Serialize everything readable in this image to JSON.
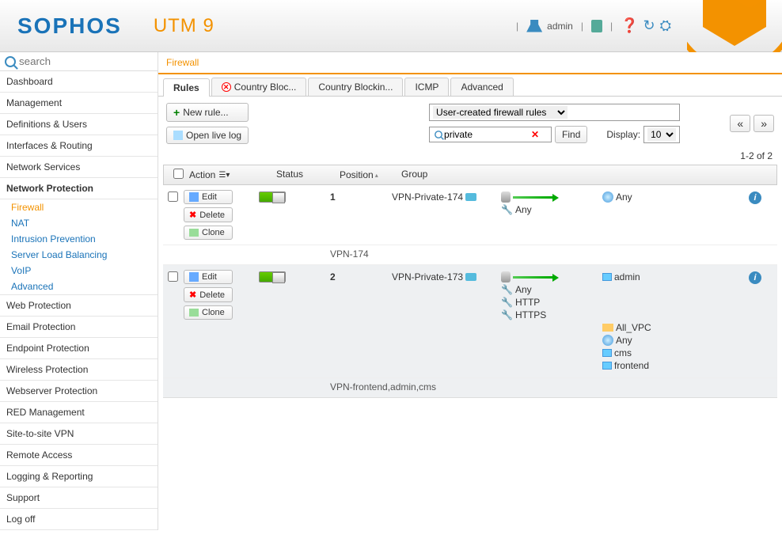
{
  "header": {
    "brand": "SOPHOS",
    "product": "UTM 9",
    "user": "admin"
  },
  "sidebar": {
    "search_placeholder": "search",
    "items": [
      {
        "label": "Dashboard"
      },
      {
        "label": "Management"
      },
      {
        "label": "Definitions & Users"
      },
      {
        "label": "Interfaces & Routing"
      },
      {
        "label": "Network Services"
      },
      {
        "label": "Network Protection",
        "active": true,
        "subs": [
          {
            "label": "Firewall",
            "active": true
          },
          {
            "label": "NAT"
          },
          {
            "label": "Intrusion Prevention"
          },
          {
            "label": "Server Load Balancing"
          },
          {
            "label": "VoIP"
          },
          {
            "label": "Advanced"
          }
        ]
      },
      {
        "label": "Web Protection"
      },
      {
        "label": "Email Protection"
      },
      {
        "label": "Endpoint Protection"
      },
      {
        "label": "Wireless Protection"
      },
      {
        "label": "Webserver Protection"
      },
      {
        "label": "RED Management"
      },
      {
        "label": "Site-to-site VPN"
      },
      {
        "label": "Remote Access"
      },
      {
        "label": "Logging & Reporting"
      },
      {
        "label": "Support"
      },
      {
        "label": "Log off"
      }
    ]
  },
  "breadcrumb": "Firewall",
  "tabs": [
    {
      "label": "Rules",
      "active": true
    },
    {
      "label": "Country Bloc...",
      "icon": "blocked"
    },
    {
      "label": "Country Blockin..."
    },
    {
      "label": "ICMP"
    },
    {
      "label": "Advanced"
    }
  ],
  "toolbar": {
    "new_rule": "New rule...",
    "open_log": "Open live log",
    "filter_select": "User-created firewall rules",
    "search_value": "private",
    "find": "Find",
    "display_label": "Display:",
    "display_value": "10",
    "count_text": "1-2 of 2"
  },
  "table": {
    "headers": {
      "action": "Action",
      "status": "Status",
      "position": "Position",
      "group": "Group"
    },
    "action_labels": {
      "edit": "Edit",
      "delete": "Delete",
      "clone": "Clone"
    }
  },
  "rules": [
    {
      "position": "1",
      "source": "VPN-Private-174",
      "services": [
        "Any"
      ],
      "destinations": [
        {
          "type": "any",
          "label": "Any"
        }
      ],
      "name": "VPN-174"
    },
    {
      "position": "2",
      "source": "VPN-Private-173",
      "services": [
        "Any",
        "HTTP",
        "HTTPS"
      ],
      "destinations": [
        {
          "type": "host",
          "label": "admin"
        },
        {
          "type": "folder",
          "label": "All_VPC"
        },
        {
          "type": "any",
          "label": "Any"
        },
        {
          "type": "host",
          "label": "cms"
        },
        {
          "type": "host",
          "label": "frontend"
        }
      ],
      "name": "VPN-frontend,admin,cms"
    }
  ]
}
